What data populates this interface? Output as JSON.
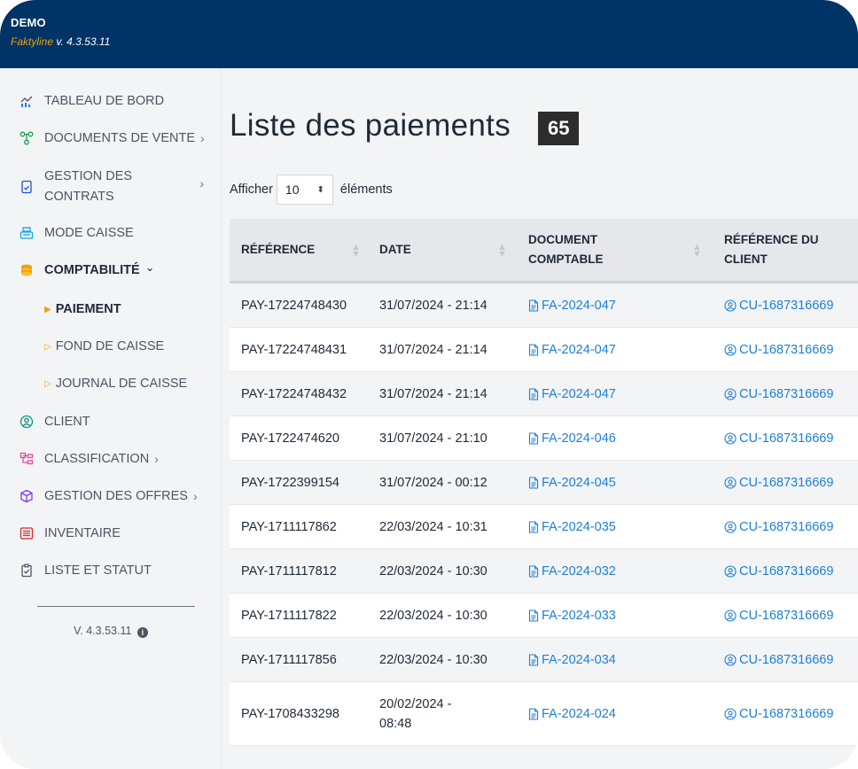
{
  "header": {
    "brand": "DEMO",
    "product": "Faktyline",
    "version": "v. 4.3.53.11"
  },
  "sidebar": {
    "items": [
      {
        "label": "TABLEAU DE BORD",
        "icon": "chart-icon"
      },
      {
        "label": "DOCUMENTS DE VENTE",
        "icon": "flow-icon",
        "chevron": "›"
      },
      {
        "label_line1": "GESTION DES",
        "label_line2": "CONTRATS",
        "icon": "contract-icon",
        "chevron": "›"
      },
      {
        "label": "MODE CAISSE",
        "icon": "cash-register-icon"
      },
      {
        "label": "COMPTABILITÉ",
        "icon": "coins-icon",
        "chevron": "⌄"
      },
      {
        "label": "CLIENT",
        "icon": "user-circle-icon"
      },
      {
        "label": "CLASSIFICATION",
        "icon": "classification-icon",
        "chevron": "›"
      },
      {
        "label": "GESTION DES OFFRES",
        "icon": "box-icon",
        "chevron": "›"
      },
      {
        "label": "INVENTAIRE",
        "icon": "list-icon"
      },
      {
        "label": "LISTE ET STATUT",
        "icon": "clipboard-icon"
      }
    ],
    "sub_items": [
      {
        "label": "PAIEMENT",
        "active": true
      },
      {
        "label": "FOND DE CAISSE",
        "active": false
      },
      {
        "label": "JOURNAL DE CAISSE",
        "active": false
      }
    ],
    "version": "V. 4.3.53.11",
    "info_glyph": "i"
  },
  "main": {
    "title": "Liste des paiements",
    "count": "65",
    "show_prefix": "Afficher",
    "page_size": "10",
    "show_suffix": "éléments",
    "columns": [
      {
        "line1": "RÉFÉRENCE",
        "line2": ""
      },
      {
        "line1": "DATE",
        "line2": ""
      },
      {
        "line1": "DOCUMENT",
        "line2": "COMPTABLE"
      },
      {
        "line1": "RÉFÉRENCE DU",
        "line2": "CLIENT"
      }
    ],
    "rows": [
      {
        "ref": "PAY-17224748430",
        "date": "31/07/2024 - 21:14",
        "doc": "FA-2024-047",
        "client": "CU-1687316669"
      },
      {
        "ref": "PAY-17224748431",
        "date": "31/07/2024 - 21:14",
        "doc": "FA-2024-047",
        "client": "CU-1687316669"
      },
      {
        "ref": "PAY-17224748432",
        "date": "31/07/2024 - 21:14",
        "doc": "FA-2024-047",
        "client": "CU-1687316669"
      },
      {
        "ref": "PAY-1722474620",
        "date": "31/07/2024 - 21:10",
        "doc": "FA-2024-046",
        "client": "CU-1687316669"
      },
      {
        "ref": "PAY-1722399154",
        "date": "31/07/2024 - 00:12",
        "doc": "FA-2024-045",
        "client": "CU-1687316669"
      },
      {
        "ref": "PAY-1711117862",
        "date": "22/03/2024 - 10:31",
        "doc": "FA-2024-035",
        "client": "CU-1687316669"
      },
      {
        "ref": "PAY-1711117812",
        "date": "22/03/2024 - 10:30",
        "doc": "FA-2024-032",
        "client": "CU-1687316669"
      },
      {
        "ref": "PAY-1711117822",
        "date": "22/03/2024 - 10:30",
        "doc": "FA-2024-033",
        "client": "CU-1687316669"
      },
      {
        "ref": "PAY-1711117856",
        "date": "22/03/2024 - 10:30",
        "doc": "FA-2024-034",
        "client": "CU-1687316669"
      },
      {
        "ref": "PAY-1708433298",
        "date_line1": "20/02/2024 -",
        "date_line2": "08:48",
        "doc": "FA-2024-024",
        "client": "CU-1687316669"
      }
    ]
  },
  "colors": {
    "header_bg": "#003366",
    "accent": "#f59e0b",
    "link": "#1d7fd6"
  }
}
